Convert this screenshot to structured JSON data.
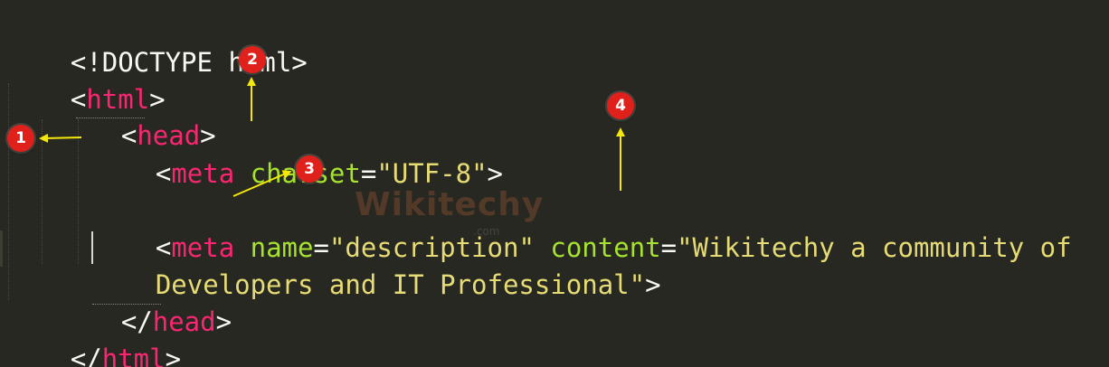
{
  "code": {
    "doctype": "<!DOCTYPE html>",
    "lt": "<",
    "gt": ">",
    "lt_slash": "</",
    "eq": "=",
    "space": " ",
    "html_tag": "html",
    "head_tag": "head",
    "meta_tag": "meta",
    "charset_attr": "charset",
    "charset_value": "\"UTF-8\"",
    "name_attr": "name",
    "name_value": "\"description\"",
    "content_attr": "content",
    "content_value_part1": "\"Wikitechy a community of",
    "content_value_part2": "Developers and IT Professional\""
  },
  "callouts": {
    "one": "1",
    "two": "2",
    "three": "3",
    "four": "4"
  },
  "watermark": {
    "brand": "Wikitechy",
    "domain": ".com"
  },
  "colors": {
    "background": "#272822",
    "punctuation": "#F8F8F2",
    "tag": "#F92672",
    "attribute": "#A6E22E",
    "string": "#E6DB74",
    "badge": "#E0201A",
    "arrow": "#F4E80A"
  }
}
